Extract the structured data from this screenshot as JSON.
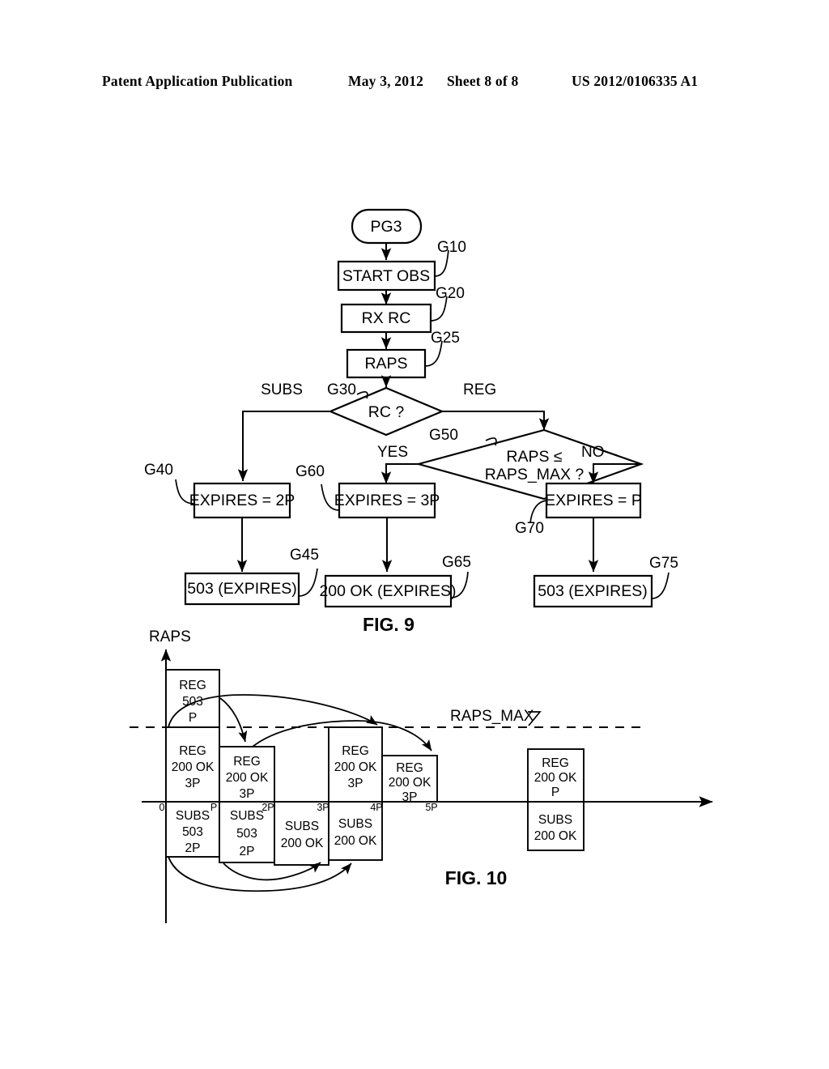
{
  "header": {
    "publication": "Patent Application Publication",
    "date": "May 3, 2012",
    "sheet": "Sheet 8 of 8",
    "number": "US 2012/0106335 A1"
  },
  "fig9": {
    "caption": "FIG. 9",
    "nodes": {
      "start": "PG3",
      "start_obs": "START OBS",
      "rx_rc": "RX RC",
      "raps": "RAPS",
      "decision_rc": "RC ?",
      "decision_raps_l1": "RAPS ≤",
      "decision_raps_l2": "RAPS_MAX ?",
      "expires_2p": "EXPIRES = 2P",
      "expires_3p": "EXPIRES = 3P",
      "expires_p": "EXPIRES = P",
      "resp_503_left": "503 (EXPIRES)",
      "resp_200ok": "200 OK (EXPIRES)",
      "resp_503_right": "503 (EXPIRES)"
    },
    "refs": {
      "g10": "G10",
      "g20": "G20",
      "g25": "G25",
      "g30": "G30",
      "g40": "G40",
      "g45": "G45",
      "g50": "G50",
      "g60": "G60",
      "g65": "G65",
      "g70": "G70",
      "g75": "G75"
    },
    "edge_labels": {
      "subs": "SUBS",
      "reg": "REG",
      "yes": "YES",
      "no": "NO"
    }
  },
  "fig10": {
    "caption": "FIG. 10",
    "axis": {
      "y_label": "RAPS",
      "threshold_label": "RAPS_MAX",
      "x_ticks": [
        "0",
        "P",
        "2P",
        "3P",
        "4P",
        "5P"
      ]
    },
    "blocks": [
      {
        "id": "b1",
        "above_top": {
          "l1": "REG",
          "l2": "503",
          "l3": "P"
        },
        "above_bottom": {
          "l1": "REG",
          "l2": "200 OK",
          "l3": "3P"
        },
        "below": {
          "l1": "SUBS",
          "l2": "503",
          "l3": "2P"
        }
      },
      {
        "id": "b2",
        "above_bottom": {
          "l1": "REG",
          "l2": "200 OK",
          "l3": "3P"
        },
        "below": {
          "l1": "SUBS",
          "l2": "503",
          "l3": "2P"
        }
      },
      {
        "id": "b3",
        "below": {
          "l1": "SUBS",
          "l2": "200 OK"
        }
      },
      {
        "id": "b4",
        "above_bottom": {
          "l1": "REG",
          "l2": "200 OK",
          "l3": "3P"
        },
        "below": {
          "l1": "SUBS",
          "l2": "200 OK"
        }
      },
      {
        "id": "b5",
        "above_bottom": {
          "l1": "REG",
          "l2": "200 OK",
          "l3": "3P"
        }
      },
      {
        "id": "b6",
        "above_bottom": {
          "l1": "REG",
          "l2": "200 OK",
          "l3": "P"
        },
        "below": {
          "l1": "SUBS",
          "l2": "200 OK"
        }
      }
    ]
  }
}
